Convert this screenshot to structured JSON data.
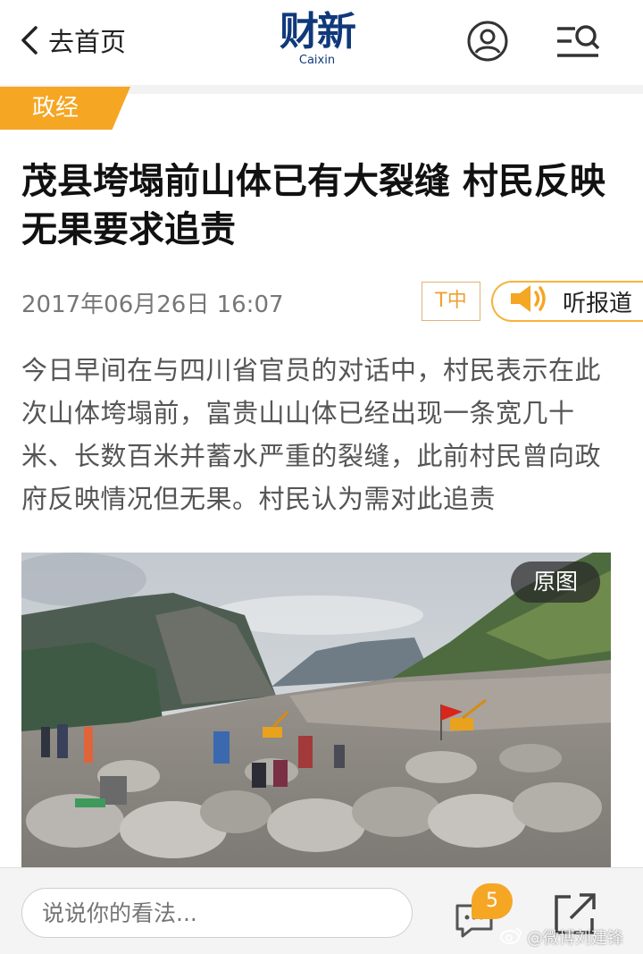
{
  "header": {
    "back_label": "去首页",
    "logo_cn": "财新",
    "logo_en": "Caixin",
    "icons": {
      "back": "chevron-left-icon",
      "user": "user-icon",
      "menu": "menu-search-icon"
    },
    "brand_color": "#10397a"
  },
  "article": {
    "category": "政经",
    "category_color": "#f5a623",
    "title": "茂县垮塌前山体已有大裂缝 村民反映无果要求追责",
    "datetime": "2017年06月26日 16:07",
    "font_size_label": "T中",
    "listen_label": "听报道",
    "summary": "今日早间在与四川省官员的对话中，村民表示在此次山体垮塌前，富贵山山体已经出现一条宽几十米、长数百米并蓄水严重的裂缝，此前村民曾向政府反映情况但无果。村民认为需对此追责",
    "photo": {
      "original_label": "原图"
    }
  },
  "bottom": {
    "comment_placeholder": "说说你的看法...",
    "comment_count": "5",
    "icons": {
      "comments": "comment-bubble-icon",
      "share": "share-icon"
    }
  },
  "watermark": {
    "text": "@微博刘建锋",
    "icon": "weibo-logo-icon"
  }
}
